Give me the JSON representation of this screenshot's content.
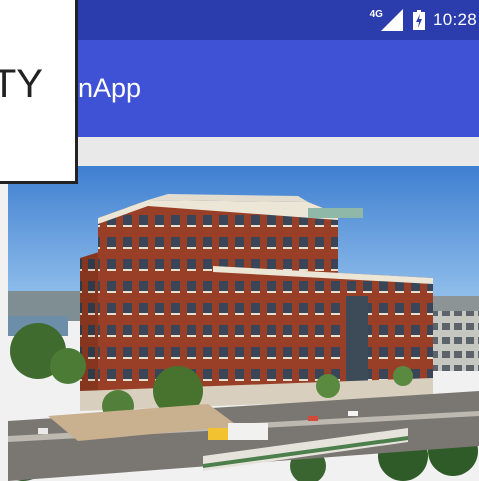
{
  "status_bar": {
    "network_type": "4G",
    "signal_icon": "signal-bars-icon",
    "battery_icon": "battery-charging-icon",
    "time": "10:28",
    "color": "#2b3dad"
  },
  "app_bar": {
    "title": "nApp",
    "color": "#3f51d5"
  },
  "content": {
    "image_subject": "brick-office-building-photo"
  },
  "overlay": {
    "text": "TY"
  }
}
